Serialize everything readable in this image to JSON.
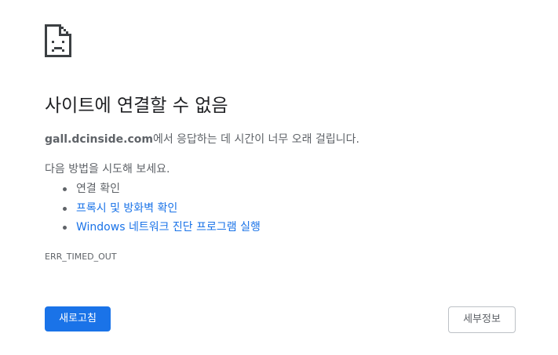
{
  "error_page": {
    "icon": "sad-document-icon",
    "title": "사이트에 연결할 수 없음",
    "host": "gall.dcinside.com",
    "summary_suffix": "에서 응답하는 데 시간이 너무 오래 걸립니다.",
    "suggestions_intro": "다음 방법을 시도해 보세요.",
    "suggestions": [
      {
        "label": "연결 확인",
        "is_link": false
      },
      {
        "label": "프록시 및 방화벽 확인",
        "is_link": true
      },
      {
        "label": "Windows 네트워크 진단 프로그램 실행",
        "is_link": true
      }
    ],
    "error_code": "ERR_TIMED_OUT"
  },
  "buttons": {
    "reload_label": "새로고침",
    "details_label": "세부정보"
  },
  "colors": {
    "primary_blue": "#1a73e8",
    "text_dark": "#202124",
    "text_gray": "#5f6368",
    "icon_dark": "#3c4043"
  }
}
